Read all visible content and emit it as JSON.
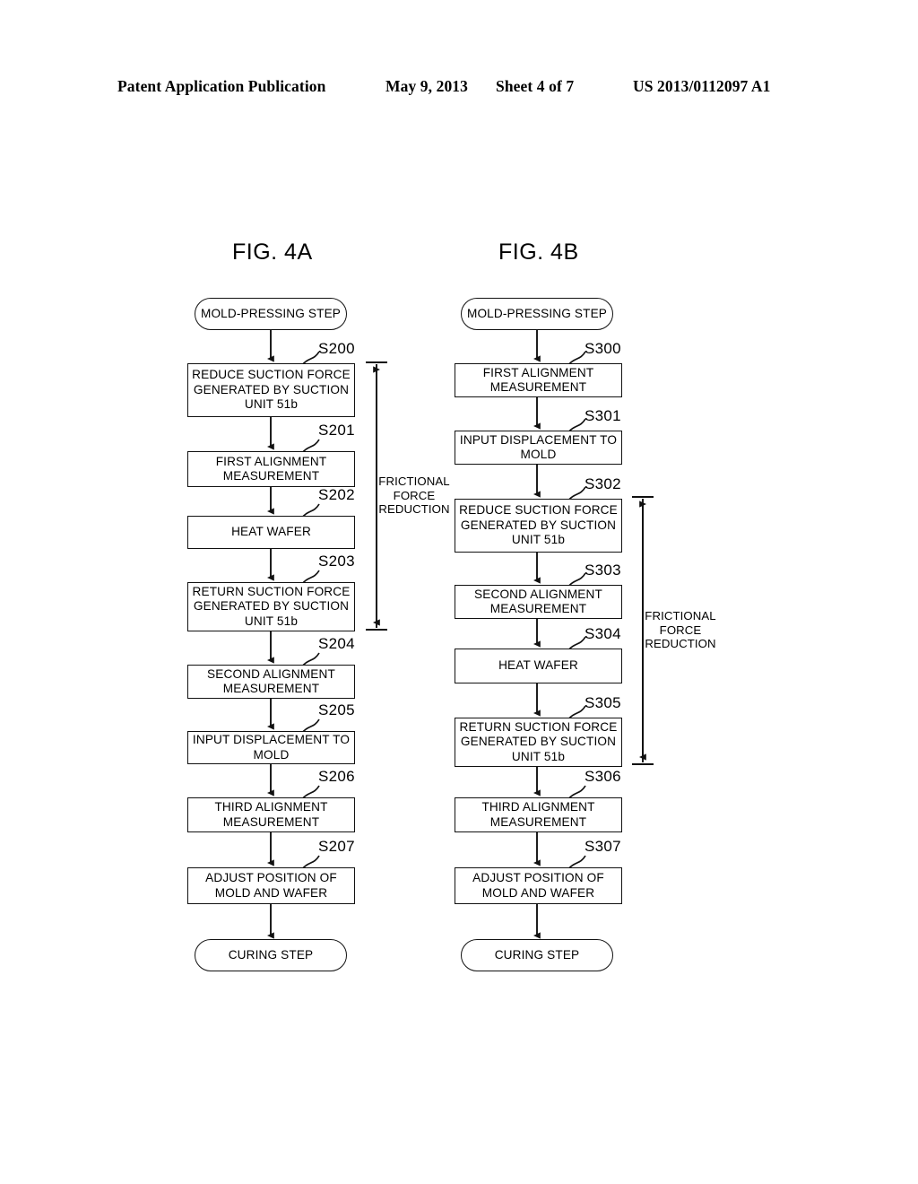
{
  "header": {
    "publication": "Patent Application Publication",
    "date": "May 9, 2013",
    "sheet": "Sheet 4 of 7",
    "doc_number": "US 2013/0112097 A1"
  },
  "figures": [
    {
      "caption": "FIG. 4A",
      "bracket_label": "FRICTIONAL\nFORCE\nREDUCTION",
      "nodes": [
        {
          "type": "terminal",
          "text": "MOLD-PRESSING STEP",
          "ref": ""
        },
        {
          "type": "process",
          "text": "REDUCE SUCTION FORCE\nGENERATED BY SUCTION\nUNIT 51b",
          "ref": "S200"
        },
        {
          "type": "process",
          "text": "FIRST ALIGNMENT\nMEASUREMENT",
          "ref": "S201"
        },
        {
          "type": "process",
          "text": "HEAT WAFER",
          "ref": "S202"
        },
        {
          "type": "process",
          "text": "RETURN SUCTION FORCE\nGENERATED BY SUCTION\nUNIT 51b",
          "ref": "S203"
        },
        {
          "type": "process",
          "text": "SECOND ALIGNMENT\nMEASUREMENT",
          "ref": "S204"
        },
        {
          "type": "process",
          "text": "INPUT DISPLACEMENT TO\nMOLD",
          "ref": "S205"
        },
        {
          "type": "process",
          "text": "THIRD ALIGNMENT\nMEASUREMENT",
          "ref": "S206"
        },
        {
          "type": "process",
          "text": "ADJUST POSITION OF\nMOLD AND WAFER",
          "ref": "S207"
        },
        {
          "type": "terminal",
          "text": "CURING STEP",
          "ref": ""
        }
      ]
    },
    {
      "caption": "FIG. 4B",
      "bracket_label": "FRICTIONAL\nFORCE\nREDUCTION",
      "nodes": [
        {
          "type": "terminal",
          "text": "MOLD-PRESSING STEP",
          "ref": ""
        },
        {
          "type": "process",
          "text": "FIRST ALIGNMENT\nMEASUREMENT",
          "ref": "S300"
        },
        {
          "type": "process",
          "text": "INPUT DISPLACEMENT TO\nMOLD",
          "ref": "S301"
        },
        {
          "type": "process",
          "text": "REDUCE SUCTION FORCE\nGENERATED BY SUCTION\nUNIT 51b",
          "ref": "S302"
        },
        {
          "type": "process",
          "text": "SECOND ALIGNMENT\nMEASUREMENT",
          "ref": "S303"
        },
        {
          "type": "process",
          "text": "HEAT WAFER",
          "ref": "S304"
        },
        {
          "type": "process",
          "text": "RETURN SUCTION FORCE\nGENERATED BY SUCTION\nUNIT 51b",
          "ref": "S305"
        },
        {
          "type": "process",
          "text": "THIRD ALIGNMENT\nMEASUREMENT",
          "ref": "S306"
        },
        {
          "type": "process",
          "text": "ADJUST POSITION OF\nMOLD AND WAFER",
          "ref": "S307"
        },
        {
          "type": "terminal",
          "text": "CURING STEP",
          "ref": ""
        }
      ]
    }
  ],
  "colors": {
    "ink": "#000000",
    "paper": "#ffffff"
  }
}
